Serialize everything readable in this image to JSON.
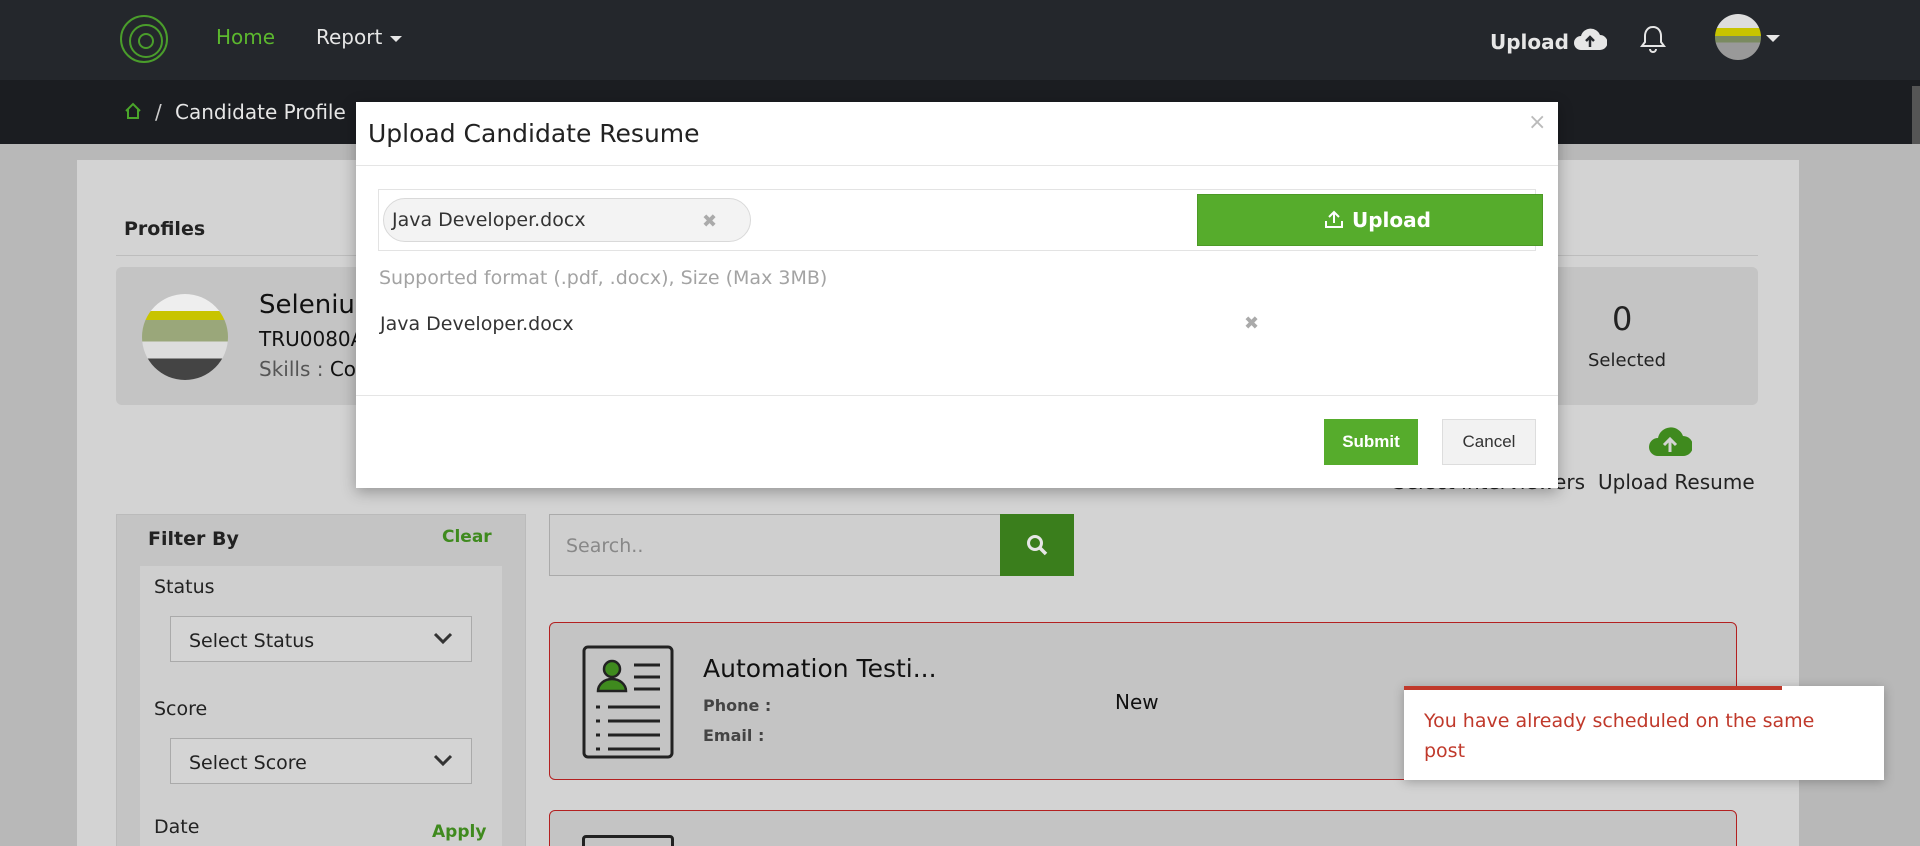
{
  "nav": {
    "home": "Home",
    "report": "Report",
    "upload": "Upload"
  },
  "breadcrumb": {
    "separator": "/",
    "current": "Candidate Profile"
  },
  "profiles": {
    "title": "Profiles",
    "name": "Seleniun",
    "id": "TRU0080A",
    "skills_label": "Skills :",
    "skills_value": "Cor",
    "selected_count": "0",
    "selected_label": "Selected"
  },
  "actions": {
    "select_interviewers": "Select Interviewers",
    "upload_resume": "Upload Resume"
  },
  "filter": {
    "title": "Filter By",
    "clear": "Clear",
    "status_label": "Status",
    "status_select": "Select Status",
    "score_label": "Score",
    "score_select": "Select Score",
    "date_label": "Date",
    "apply": "Apply"
  },
  "search": {
    "placeholder": "Search.."
  },
  "job_card": {
    "title": "Automation Testi...",
    "phone_label": "Phone :",
    "email_label": "Email :",
    "status": "New"
  },
  "modal": {
    "title": "Upload Candidate Resume",
    "close": "×",
    "file_chip": "Java Developer.docx",
    "upload_button": "Upload",
    "supported_format": "Supported format (.pdf, .docx), Size (Max 3MB)",
    "file_list_item": "Java Developer.docx",
    "remove_glyph": "✖",
    "submit": "Submit",
    "cancel": "Cancel"
  },
  "toast": {
    "message": "You have already scheduled on the same post"
  },
  "colors": {
    "brand_green": "#56ac2c",
    "nav_bg": "#24272c",
    "error_red": "#c0392b"
  }
}
